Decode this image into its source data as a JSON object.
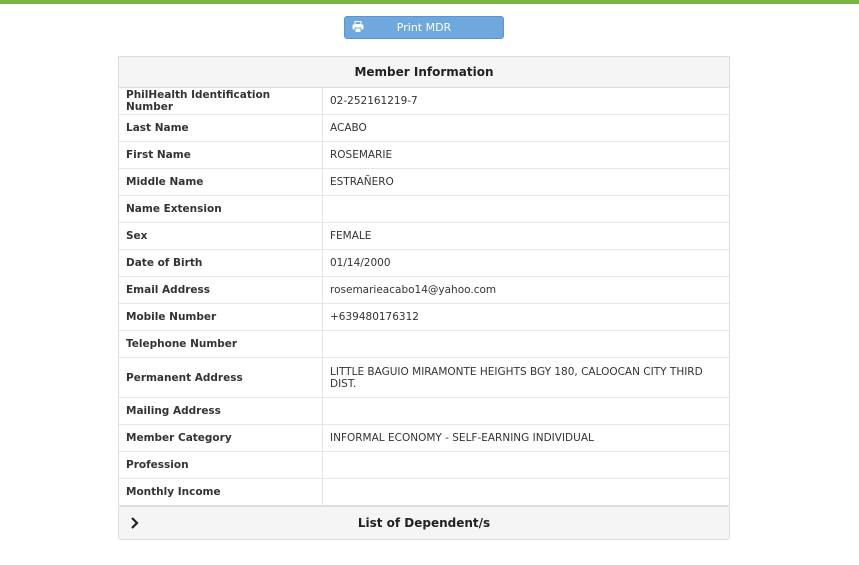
{
  "print_button": {
    "label": "Print MDR",
    "icon": "printer-icon"
  },
  "member_info": {
    "title": "Member Information",
    "rows": [
      {
        "label": "PhilHealth Identification Number",
        "value": "02-252161219-7"
      },
      {
        "label": "Last Name",
        "value": "ACABO"
      },
      {
        "label": "First Name",
        "value": "ROSEMARIE"
      },
      {
        "label": "Middle Name",
        "value": "ESTRAÑERO"
      },
      {
        "label": "Name Extension",
        "value": ""
      },
      {
        "label": "Sex",
        "value": "FEMALE"
      },
      {
        "label": "Date of Birth",
        "value": "01/14/2000"
      },
      {
        "label": "Email Address",
        "value": "rosemarieacabo14@yahoo.com"
      },
      {
        "label": "Mobile Number",
        "value": "+639480176312"
      },
      {
        "label": "Telephone Number",
        "value": ""
      },
      {
        "label": "Permanent Address",
        "value": "LITTLE BAGUIO MIRAMONTE HEIGHTS BGY 180, CALOOCAN CITY THIRD DIST."
      },
      {
        "label": "Mailing Address",
        "value": ""
      },
      {
        "label": "Member Category",
        "value": "INFORMAL ECONOMY - SELF-EARNING INDIVIDUAL"
      },
      {
        "label": "Profession",
        "value": ""
      },
      {
        "label": "Monthly Income",
        "value": ""
      }
    ]
  },
  "dependents": {
    "title": "List of Dependent/s",
    "icon": "chevron-right-icon"
  },
  "colors": {
    "accent_bar": "#7cb342",
    "button": "#6fa8dc",
    "panel_header": "#f5f5f5"
  }
}
